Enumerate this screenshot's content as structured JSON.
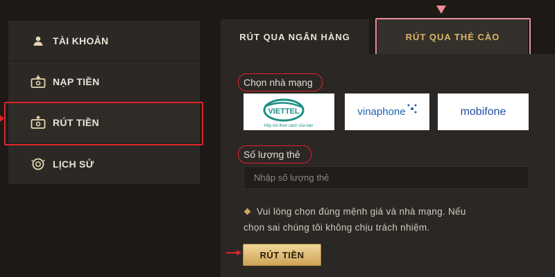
{
  "sidebar": {
    "items": [
      {
        "label": "TÀI KHOẢN",
        "icon": "user-icon"
      },
      {
        "label": "NẠP TIỀN",
        "icon": "cash-in-icon"
      },
      {
        "label": "RÚT TIỀN",
        "icon": "cash-out-icon",
        "active": true
      },
      {
        "label": "LỊCH SỬ",
        "icon": "history-icon"
      }
    ]
  },
  "tabs": [
    {
      "label": "RÚT QUA NGÂN HÀNG"
    },
    {
      "label": "RÚT QUA THẺ CÀO",
      "active": true
    }
  ],
  "form": {
    "network_label": "Chọn nhà mạng",
    "networks": [
      {
        "name": "VIETTEL",
        "tagline": "Hãy nói theo cách của bạn"
      },
      {
        "name": "vinaphone"
      },
      {
        "name": "mobifone"
      }
    ],
    "quantity_label": "Số lượng thẻ",
    "quantity_placeholder": "Nhập số lượng thẻ",
    "notice_line1": "Vui lòng chọn đúng mệnh giá và nhà mạng. Nếu",
    "notice_line2": "chọn sai chúng tôi không chịu trách nhiệm.",
    "submit_label": "RÚT TIỀN"
  },
  "colors": {
    "background": "#1c1916",
    "panel": "#2a2724",
    "gold": "#d9b56a",
    "highlight_red": "#e0242b"
  }
}
